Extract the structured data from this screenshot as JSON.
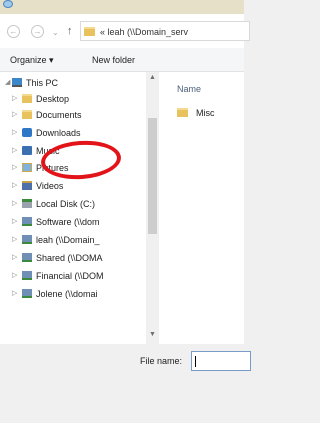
{
  "address": {
    "path": "« leah (\\\\Domain_serv"
  },
  "nav_buttons": {
    "back": "←",
    "forward": "→",
    "up": "↑",
    "dropdown": "⌄"
  },
  "toolbar": {
    "organize_label": "Organize ▾",
    "new_folder_label": "New folder"
  },
  "tree": [
    {
      "label": "This PC",
      "icon": "computer-icon",
      "expanded": true
    },
    {
      "label": "Desktop",
      "icon": "folder-icon"
    },
    {
      "label": "Documents",
      "icon": "folder-icon"
    },
    {
      "label": "Downloads",
      "icon": "downloads-icon",
      "selected": true
    },
    {
      "label": "Music",
      "icon": "music-icon"
    },
    {
      "label": "Pictures",
      "icon": "pictures-icon"
    },
    {
      "label": "Videos",
      "icon": "videos-icon"
    },
    {
      "label": "Local Disk (C:)",
      "icon": "disk-icon"
    },
    {
      "label": "Software (\\\\dom",
      "icon": "network-drive-icon"
    },
    {
      "label": "leah (\\\\Domain_",
      "icon": "network-drive-icon"
    },
    {
      "label": "Shared (\\\\DOMA",
      "icon": "network-drive-icon"
    },
    {
      "label": "Financial (\\\\DOM",
      "icon": "network-drive-icon"
    },
    {
      "label": "Jolene (\\\\domai",
      "icon": "network-drive-icon"
    }
  ],
  "file_list": {
    "column_name": "Name",
    "items": [
      {
        "name": "Misc",
        "icon": "folder-icon"
      }
    ]
  },
  "file_name": {
    "label": "File name:",
    "value": ""
  },
  "annotation": {
    "color": "#e2141a",
    "circled_item": "Downloads"
  }
}
